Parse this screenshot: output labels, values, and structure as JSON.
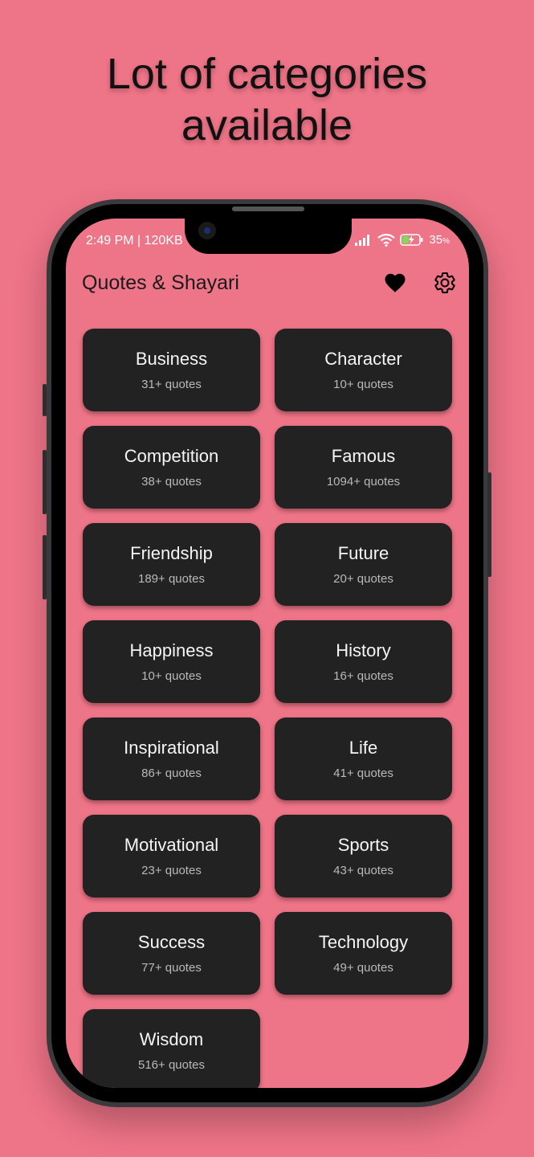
{
  "headline": {
    "line1": "Lot of categories",
    "line2": "available"
  },
  "status_bar": {
    "time_info": "2:49 PM | 120KB",
    "battery": "35",
    "battery_unit": "%"
  },
  "app": {
    "title": "Quotes & Shayari"
  },
  "header_icons": [
    "heart-icon",
    "gear-icon"
  ],
  "colors": {
    "background": "#ee7487",
    "card": "#222222",
    "card_title": "#f5f5f5",
    "card_count": "#b9b9b9"
  },
  "categories": [
    {
      "name": "Business",
      "count": "31+ quotes"
    },
    {
      "name": "Character",
      "count": "10+ quotes"
    },
    {
      "name": "Competition",
      "count": "38+ quotes"
    },
    {
      "name": "Famous",
      "count": "1094+ quotes"
    },
    {
      "name": "Friendship",
      "count": "189+ quotes"
    },
    {
      "name": "Future",
      "count": "20+ quotes"
    },
    {
      "name": "Happiness",
      "count": "10+ quotes"
    },
    {
      "name": "History",
      "count": "16+ quotes"
    },
    {
      "name": "Inspirational",
      "count": "86+ quotes"
    },
    {
      "name": "Life",
      "count": "41+ quotes"
    },
    {
      "name": "Motivational",
      "count": "23+ quotes"
    },
    {
      "name": "Sports",
      "count": "43+ quotes"
    },
    {
      "name": "Success",
      "count": "77+ quotes"
    },
    {
      "name": "Technology",
      "count": "49+ quotes"
    },
    {
      "name": "Wisdom",
      "count": "516+ quotes"
    }
  ]
}
